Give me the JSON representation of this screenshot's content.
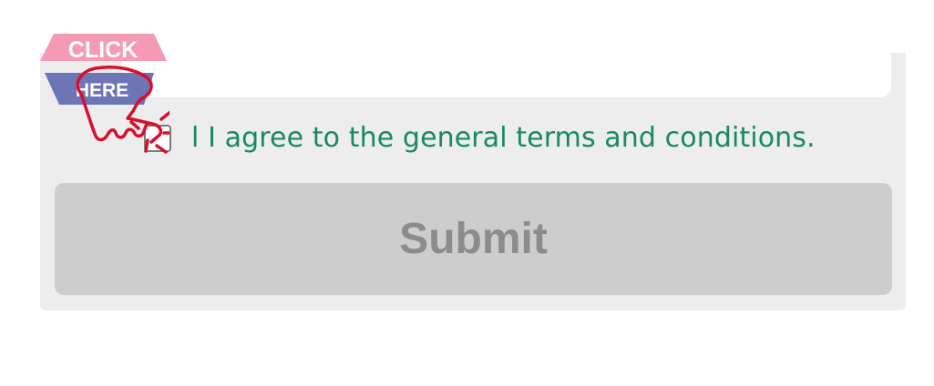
{
  "badge": {
    "top_text": "CLICK",
    "bottom_text": "HERE",
    "icon": "pointing-hand-icon",
    "colors": {
      "top": "#f59ab4",
      "bottom": "#6d75b7",
      "hand_outline": "#d80f2c",
      "text": "#ffffff"
    }
  },
  "agreement": {
    "checked": false,
    "label": "l I agree to the general terms and conditions."
  },
  "submit": {
    "label": "Submit",
    "disabled": true
  },
  "colors": {
    "panel_background": "#ededed",
    "label_color": "#178a63",
    "button_background": "#cdcdcd",
    "button_text": "#8c8c8c"
  }
}
